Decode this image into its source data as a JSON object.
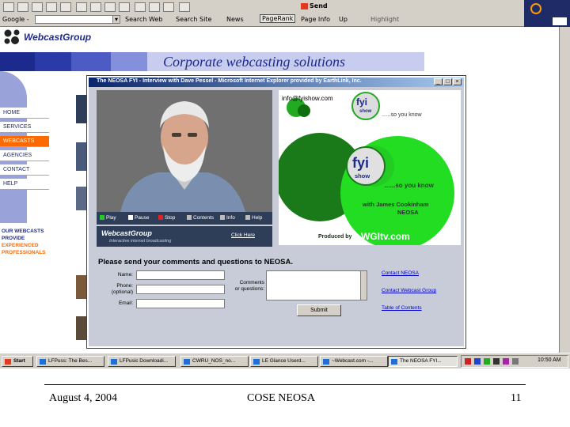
{
  "browser": {
    "toolbar_icons": [
      "back-icon",
      "forward-icon",
      "stop-icon",
      "refresh-icon",
      "home-icon",
      "search-icon",
      "favorites-icon",
      "history-icon",
      "mail-icon",
      "print-icon",
      "edit-icon",
      "discuss-icon",
      "messenger-icon"
    ],
    "send_label": "Send",
    "google_label": "Google -",
    "search_web_label": "Search Web",
    "search_site_label": "Search Site",
    "news_label": "News",
    "pagerank_label": "PageRank",
    "page_info_label": "Page Info",
    "up_label": "Up",
    "highlight_label": "Highlight"
  },
  "site": {
    "logo_text": "WebcastGroup",
    "banner_title": "Corporate webcasting solutions",
    "nav": [
      {
        "label": "HOME",
        "active": false
      },
      {
        "label": "SERVICES",
        "active": false
      },
      {
        "label": "WEBCASTS",
        "active": true
      },
      {
        "label": "AGENCIES",
        "active": false
      },
      {
        "label": "CONTACT",
        "active": false
      },
      {
        "label": "HELP",
        "active": false
      }
    ],
    "promo_line1": "OUR WEBCASTS",
    "promo_line2": "PROVIDE",
    "promo_line3": "EXPERIENCED",
    "promo_line4": "PROFESSIONALS"
  },
  "popup": {
    "title": "The NEOSA FYI - Interview with Dave Pessel - Microsoft Internet Explorer provided by EarthLink, Inc.",
    "controls": [
      {
        "label": "Play",
        "icon": "play-icon"
      },
      {
        "label": "Pause",
        "icon": "pause-icon"
      },
      {
        "label": "Stop",
        "icon": "stop-icon"
      },
      {
        "label": "Contents",
        "icon": "contents-icon"
      },
      {
        "label": "Info",
        "icon": "info-icon"
      },
      {
        "label": "Help",
        "icon": "help-icon"
      }
    ],
    "wcg_strip_logo": "WebcastGroup",
    "wcg_strip_tagline": "Interactive internet broadcasting",
    "wcg_strip_link": "Click Here",
    "email": "info@fyishow.com",
    "fyi_text": "fyi",
    "show_text": "show",
    "tagline_small": "......so you know",
    "tagline_large": "......so you know",
    "host_line1": "with James Cookinham",
    "host_line2": "NEOSA",
    "produced_by": "Produced by",
    "producer": "WGItv.com",
    "comments_title": "Please send your comments and questions to NEOSA.",
    "name_label": "Name:",
    "phone_label": "Phone:",
    "phone_optional": "(optional)",
    "email_label": "Email:",
    "comments_label": "Comments",
    "questions_label": "or questions:",
    "submit_label": "Submit",
    "links": [
      "Contact NEOSA",
      "Contact Webcast Group",
      "Table of Contents"
    ]
  },
  "taskbar": {
    "start_label": "Start",
    "tasks": [
      "LFPuss: The Bes...",
      "LFPusic Downloadi...",
      "CWRU_NOS_no...",
      "LE Glance Userd...",
      "~Webcast.com -...",
      "The NEOSA FYI..."
    ],
    "clock": "10:50 AM",
    "colors": {
      "titlebar_start": "#0a246a",
      "titlebar_end": "#a6caf0",
      "accent_orange": "#ff6a00",
      "brand_blue": "#1c2a8e",
      "fyi_green": "#22dd22"
    }
  },
  "slide_footer": {
    "date": "August 4, 2004",
    "center": "COSE NEOSA",
    "page": "11"
  }
}
